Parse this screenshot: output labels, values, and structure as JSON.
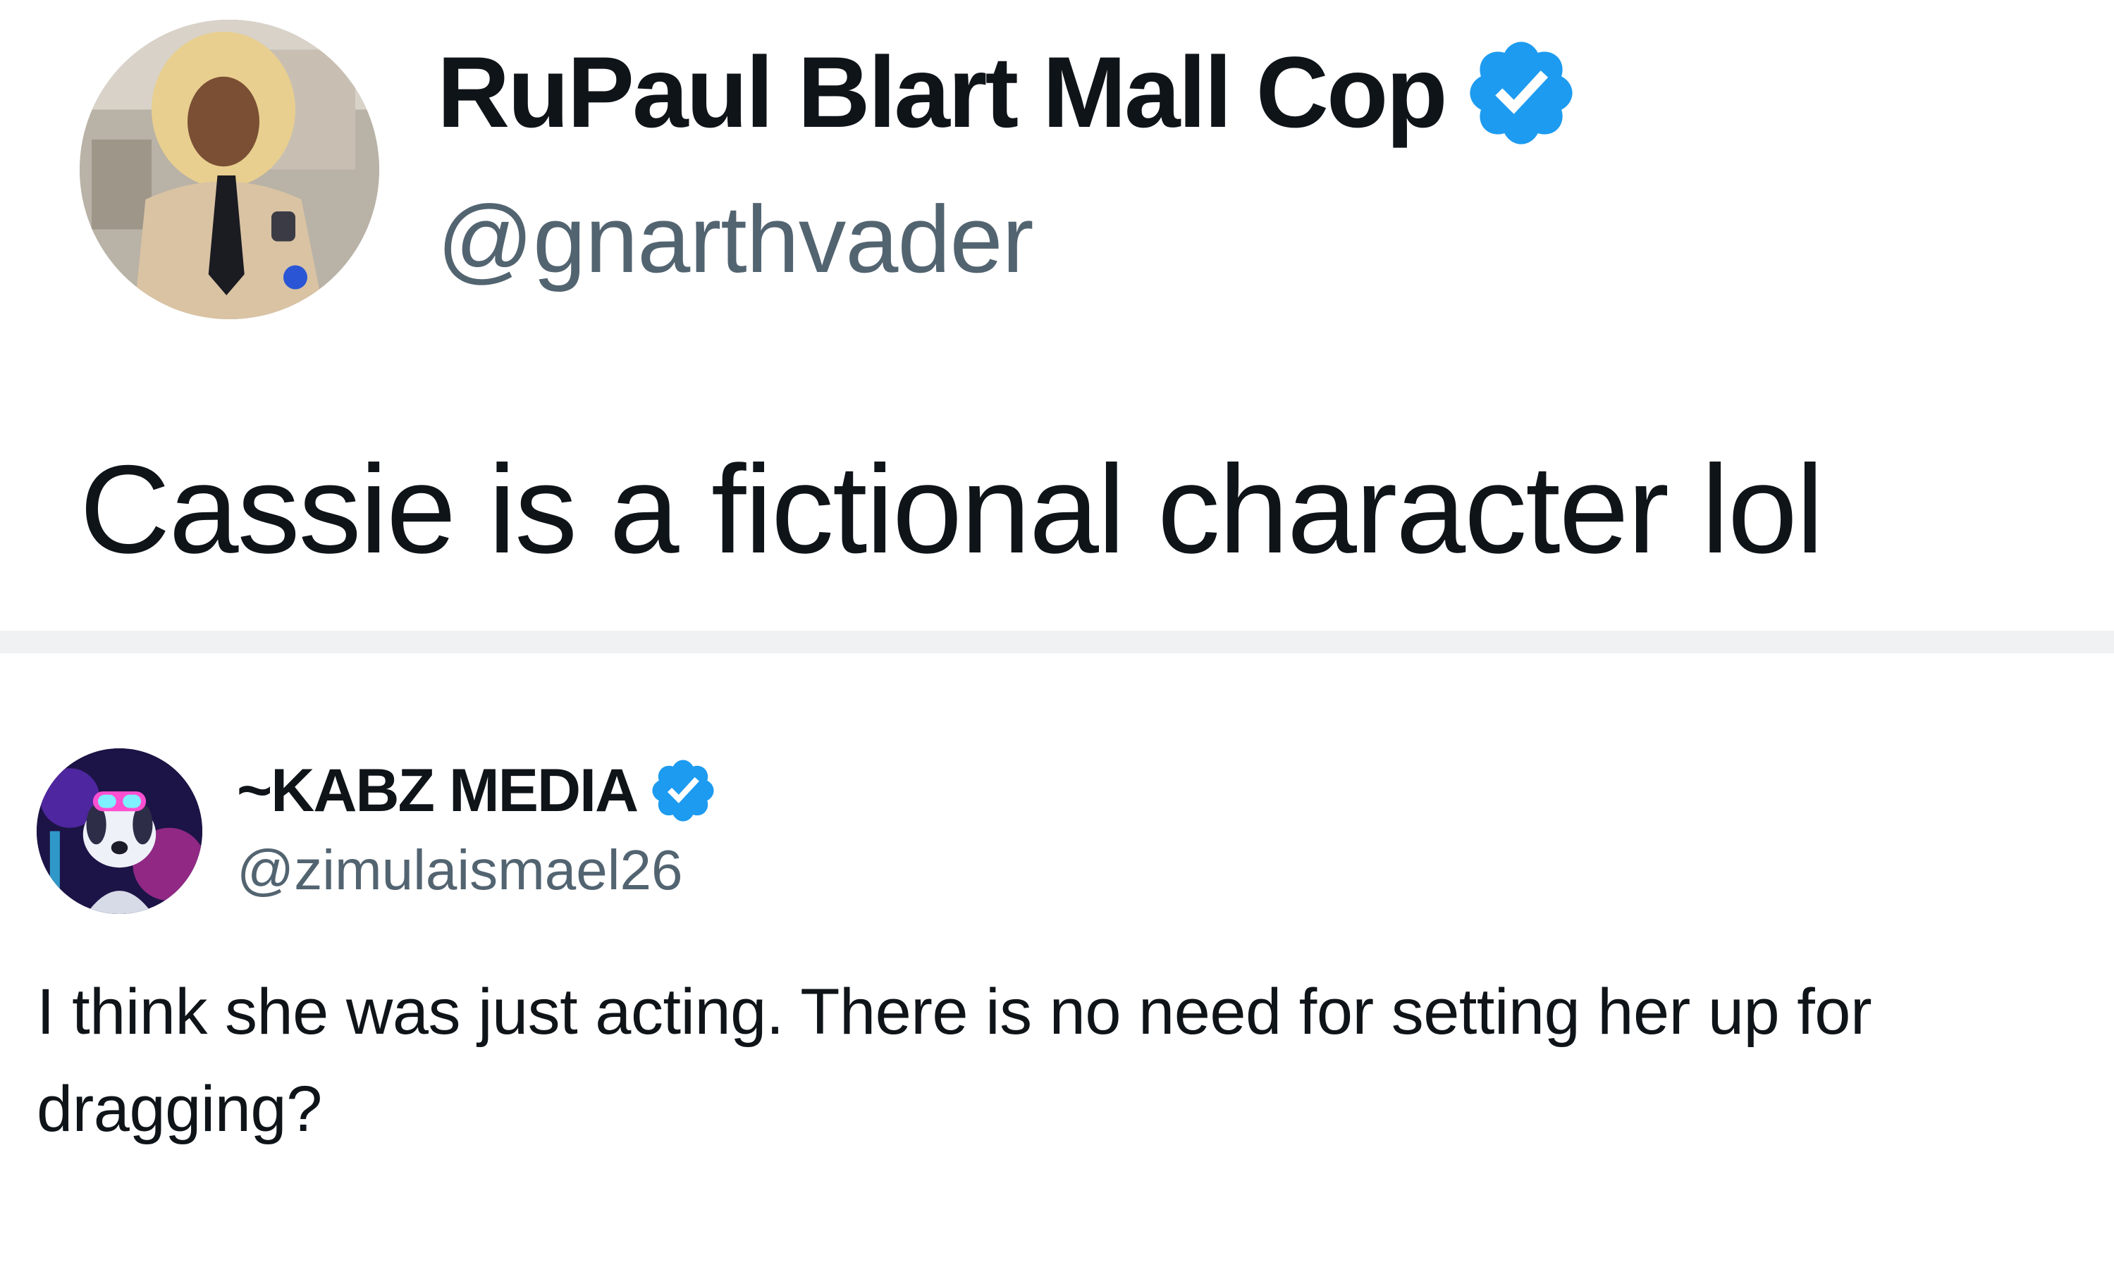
{
  "colors": {
    "text_primary": "#0f1419",
    "text_secondary": "#536471",
    "verified_blue": "#1d9bf0",
    "divider": "#eff1f2"
  },
  "tweet_main": {
    "display_name": "RuPaul Blart Mall Cop",
    "handle": "@gnarthvader",
    "verified": true,
    "verified_icon": "verified-badge-icon",
    "avatar": "user-avatar",
    "text": "Cassie is a fictional character lol"
  },
  "tweet_reply": {
    "display_name": "~KABZ MEDIA",
    "handle": "@zimulaismael26",
    "verified": true,
    "verified_icon": "verified-badge-icon",
    "avatar": "user-avatar",
    "text": "I think she was just acting. There is no need for setting her up for dragging?"
  }
}
